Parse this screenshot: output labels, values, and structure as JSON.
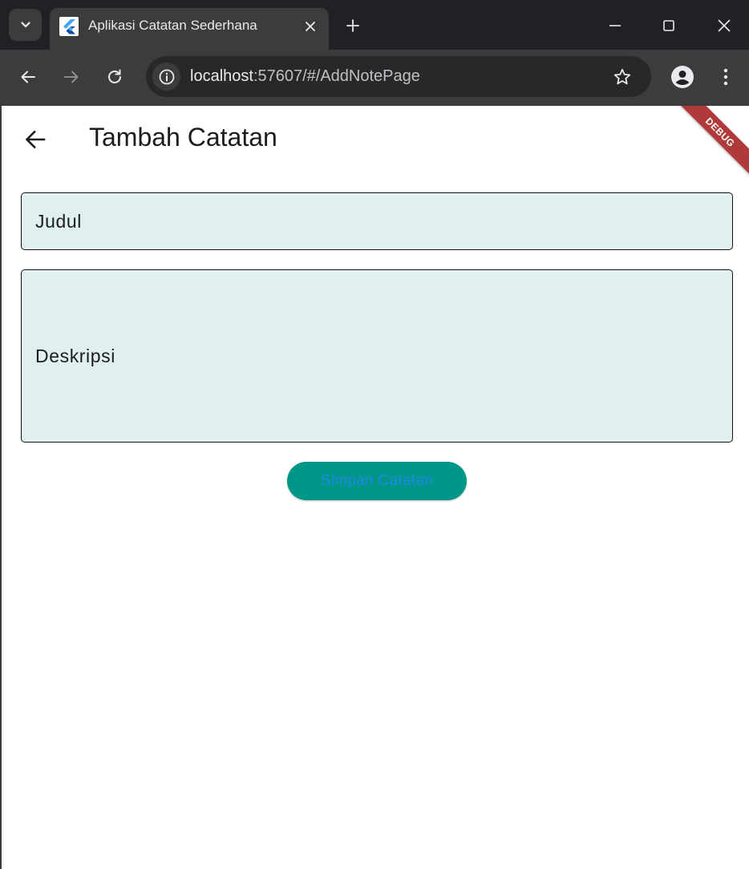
{
  "browser": {
    "tab": {
      "title": "Aplikasi Catatan Sederhana"
    },
    "address": {
      "host": "localhost",
      "path": ":57607/#/AddNotePage"
    }
  },
  "app": {
    "title": "Tambah Catatan",
    "form": {
      "title_placeholder": "Judul",
      "title_value": "",
      "description_placeholder": "Deskripsi",
      "description_value": ""
    },
    "save_label": "Simpan Catatan",
    "debug_label": "DEBUG"
  },
  "colors": {
    "field_fill": "#e0f0f0",
    "button_fill": "#009688",
    "button_text": "#1e88e5",
    "debug_ribbon": "#b03a3a"
  },
  "icons": [
    "tab-search-icon",
    "flutter-icon",
    "close-icon",
    "plus-icon",
    "minimize-icon",
    "maximize-icon",
    "window-close-icon",
    "back-icon",
    "forward-icon",
    "reload-icon",
    "info-icon",
    "star-icon",
    "profile-icon",
    "more-icon",
    "arrow-back-icon"
  ]
}
